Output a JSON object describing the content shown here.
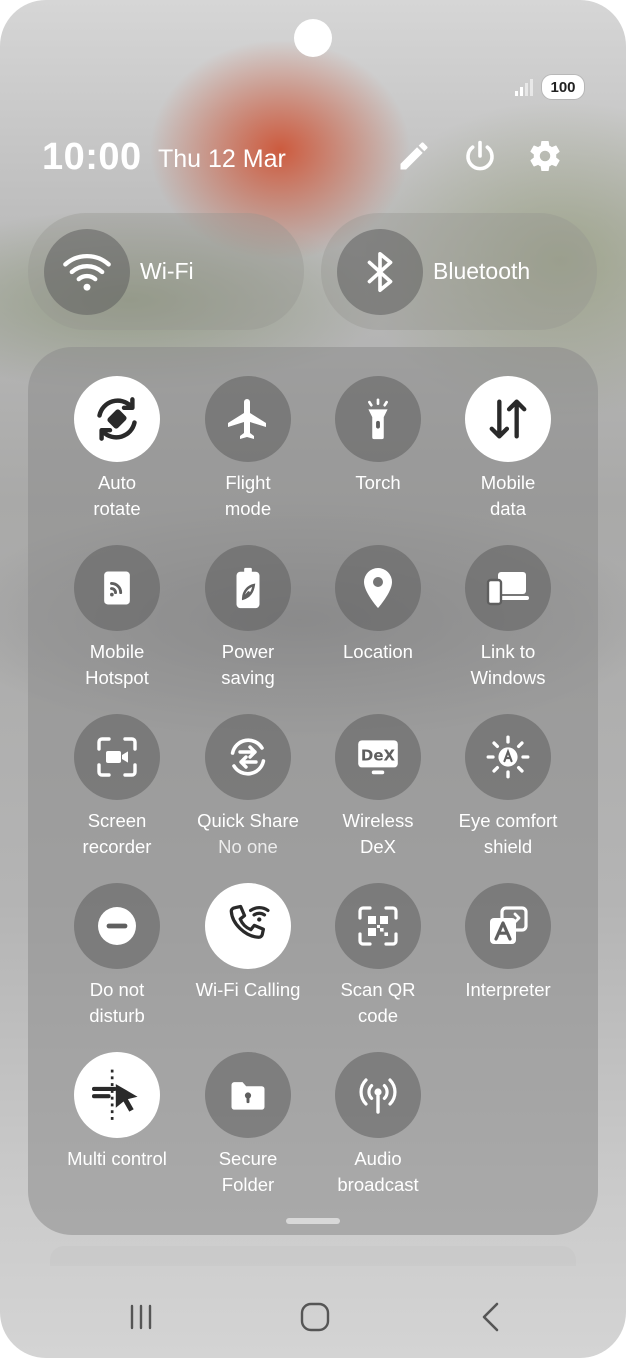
{
  "status": {
    "battery": "100",
    "time": "10:00",
    "date": "Thu 12 Mar"
  },
  "header_icons": [
    "edit-icon",
    "power-icon",
    "gear-icon"
  ],
  "connectivity": [
    {
      "name": "wifi",
      "label": "Wi-Fi",
      "icon": "wifi-icon"
    },
    {
      "name": "bluetooth",
      "label": "Bluetooth",
      "icon": "bluetooth-icon"
    }
  ],
  "tiles": [
    {
      "label1": "Auto",
      "label2": "rotate",
      "icon": "auto-rotate-icon",
      "active": true
    },
    {
      "label1": "Flight",
      "label2": "mode",
      "icon": "airplane-icon",
      "active": false
    },
    {
      "label1": "Torch",
      "label2": "",
      "icon": "torch-icon",
      "active": false
    },
    {
      "label1": "Mobile",
      "label2": "data",
      "icon": "mobile-data-icon",
      "active": true
    },
    {
      "label1": "Mobile",
      "label2": "Hotspot",
      "icon": "hotspot-icon",
      "active": false
    },
    {
      "label1": "Power",
      "label2": "saving",
      "icon": "power-saving-icon",
      "active": false
    },
    {
      "label1": "Location",
      "label2": "",
      "icon": "location-icon",
      "active": false
    },
    {
      "label1": "Link to",
      "label2": "Windows",
      "icon": "link-to-windows-icon",
      "active": false
    },
    {
      "label1": "Screen",
      "label2": "recorder",
      "icon": "screen-recorder-icon",
      "active": false
    },
    {
      "label1": "Quick Share",
      "label2": "No one",
      "icon": "quick-share-icon",
      "active": false
    },
    {
      "label1": "Wireless",
      "label2": "DeX",
      "icon": "dex-icon",
      "active": false
    },
    {
      "label1": "Eye comfort",
      "label2": "shield",
      "icon": "eye-comfort-icon",
      "active": false
    },
    {
      "label1": "Do not",
      "label2": "disturb",
      "icon": "do-not-disturb-icon",
      "active": false
    },
    {
      "label1": "Wi-Fi Calling",
      "label2": "",
      "icon": "wifi-calling-icon",
      "active": true
    },
    {
      "label1": "Scan QR",
      "label2": "code",
      "icon": "qr-code-icon",
      "active": false
    },
    {
      "label1": "Interpreter",
      "label2": "",
      "icon": "interpreter-icon",
      "active": false
    },
    {
      "label1": "Multi control",
      "label2": "",
      "icon": "multi-control-icon",
      "active": true
    },
    {
      "label1": "Secure",
      "label2": "Folder",
      "icon": "secure-folder-icon",
      "active": false
    },
    {
      "label1": "Audio",
      "label2": "broadcast",
      "icon": "audio-broadcast-icon",
      "active": false
    }
  ],
  "dex_text": "DeX",
  "navigation": [
    "recent-apps-icon",
    "home-icon",
    "back-icon"
  ],
  "colors": {
    "active_tile": "#ffffff",
    "inactive_tile": "#5f5f5f",
    "text": "#ffffff"
  }
}
